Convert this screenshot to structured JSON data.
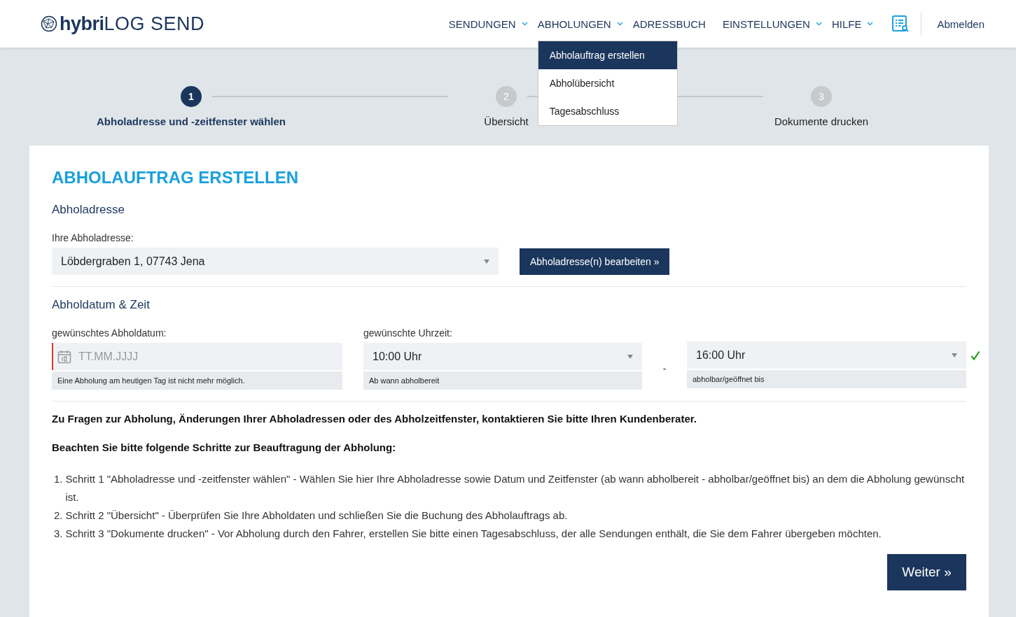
{
  "header": {
    "logo": "**hybri**LOG SEND",
    "nav": [
      {
        "label": "SENDUNGEN",
        "dropdown": true,
        "expanded": false
      },
      {
        "label": "ABHOLUNGEN",
        "dropdown": true,
        "expanded": true
      },
      {
        "label": "ADRESSBUCH",
        "dropdown": false,
        "expanded": false
      },
      {
        "label": "EINSTELLUNGEN",
        "dropdown": true,
        "expanded": false
      },
      {
        "label": "HILFE",
        "dropdown": true,
        "expanded": false
      }
    ],
    "logout": "Abmelden",
    "menu": [
      {
        "label": "Abholauftrag erstellen",
        "selected": true
      },
      {
        "label": "Abholübersicht",
        "selected": false
      },
      {
        "label": "Tagesabschluss",
        "selected": false
      }
    ]
  },
  "steps": [
    {
      "number": "1",
      "label": "Abholadresse und -zeitfenster wählen",
      "selected": true
    },
    {
      "number": "2",
      "label": "Übersicht",
      "selected": false
    },
    {
      "number": "3",
      "label": "Dokumente drucken",
      "selected": false
    }
  ],
  "title": "ABHOLAUFTRAG ERSTELLEN",
  "address_section": {
    "heading": "Abholadresse",
    "label": "Ihre Abholadresse:",
    "value": "Löbdergraben 1, 07743 Jena",
    "button": "Abholadresse(n) bearbeiten »"
  },
  "date_section": {
    "heading": "Abholdatum & Zeit",
    "date": {
      "label": "gewünschtes Abholdatum:",
      "placeholder": "TT.MM.JJJJ",
      "hint": "Eine Abholung am heutigen Tag ist nicht mehr möglich.",
      "invalid": true
    },
    "time_label": "gewünschte Uhrzeit:",
    "from": {
      "value": "10:00 Uhr",
      "hint": "Ab wann abholbereit"
    },
    "separator": "-",
    "to": {
      "value": "16:00 Uhr",
      "hint": "abholbar/geöffnet bis"
    },
    "valid": true
  },
  "notes": [
    "Zu Fragen zur Abholung, Änderungen Ihrer Abholadressen oder des Abholzeitfenster, kontaktieren Sie bitte Ihren Kundenberater.",
    "Beachten Sie bitte folgende Schritte zur Beauftragung der Abholung:"
  ],
  "instructions": [
    {
      "marker": "1.",
      "text": "Schritt 1 \"Abholadresse und -zeitfenster wählen\" - Wählen Sie hier Ihre Abholadresse sowie Datum und Zeitfenster (ab wann abholbereit - abholbar/geöffnet bis) an dem die Abholung gewünscht ist."
    },
    {
      "marker": "2.",
      "text": "Schritt 2 \"Übersicht\" - Überprüfen Sie Ihre Abholdaten und schließen Sie die Buchung des Abholauftrags ab."
    },
    {
      "marker": "3.",
      "text": "Schritt 3 \"Dokumente drucken\" - Vor Abholung durch den Fahrer, erstellen Sie bitte einen Tagesabschluss, der alle Sendungen enthält, die Sie dem Fahrer übergeben möchten."
    }
  ],
  "next_button": "Weiter »"
}
